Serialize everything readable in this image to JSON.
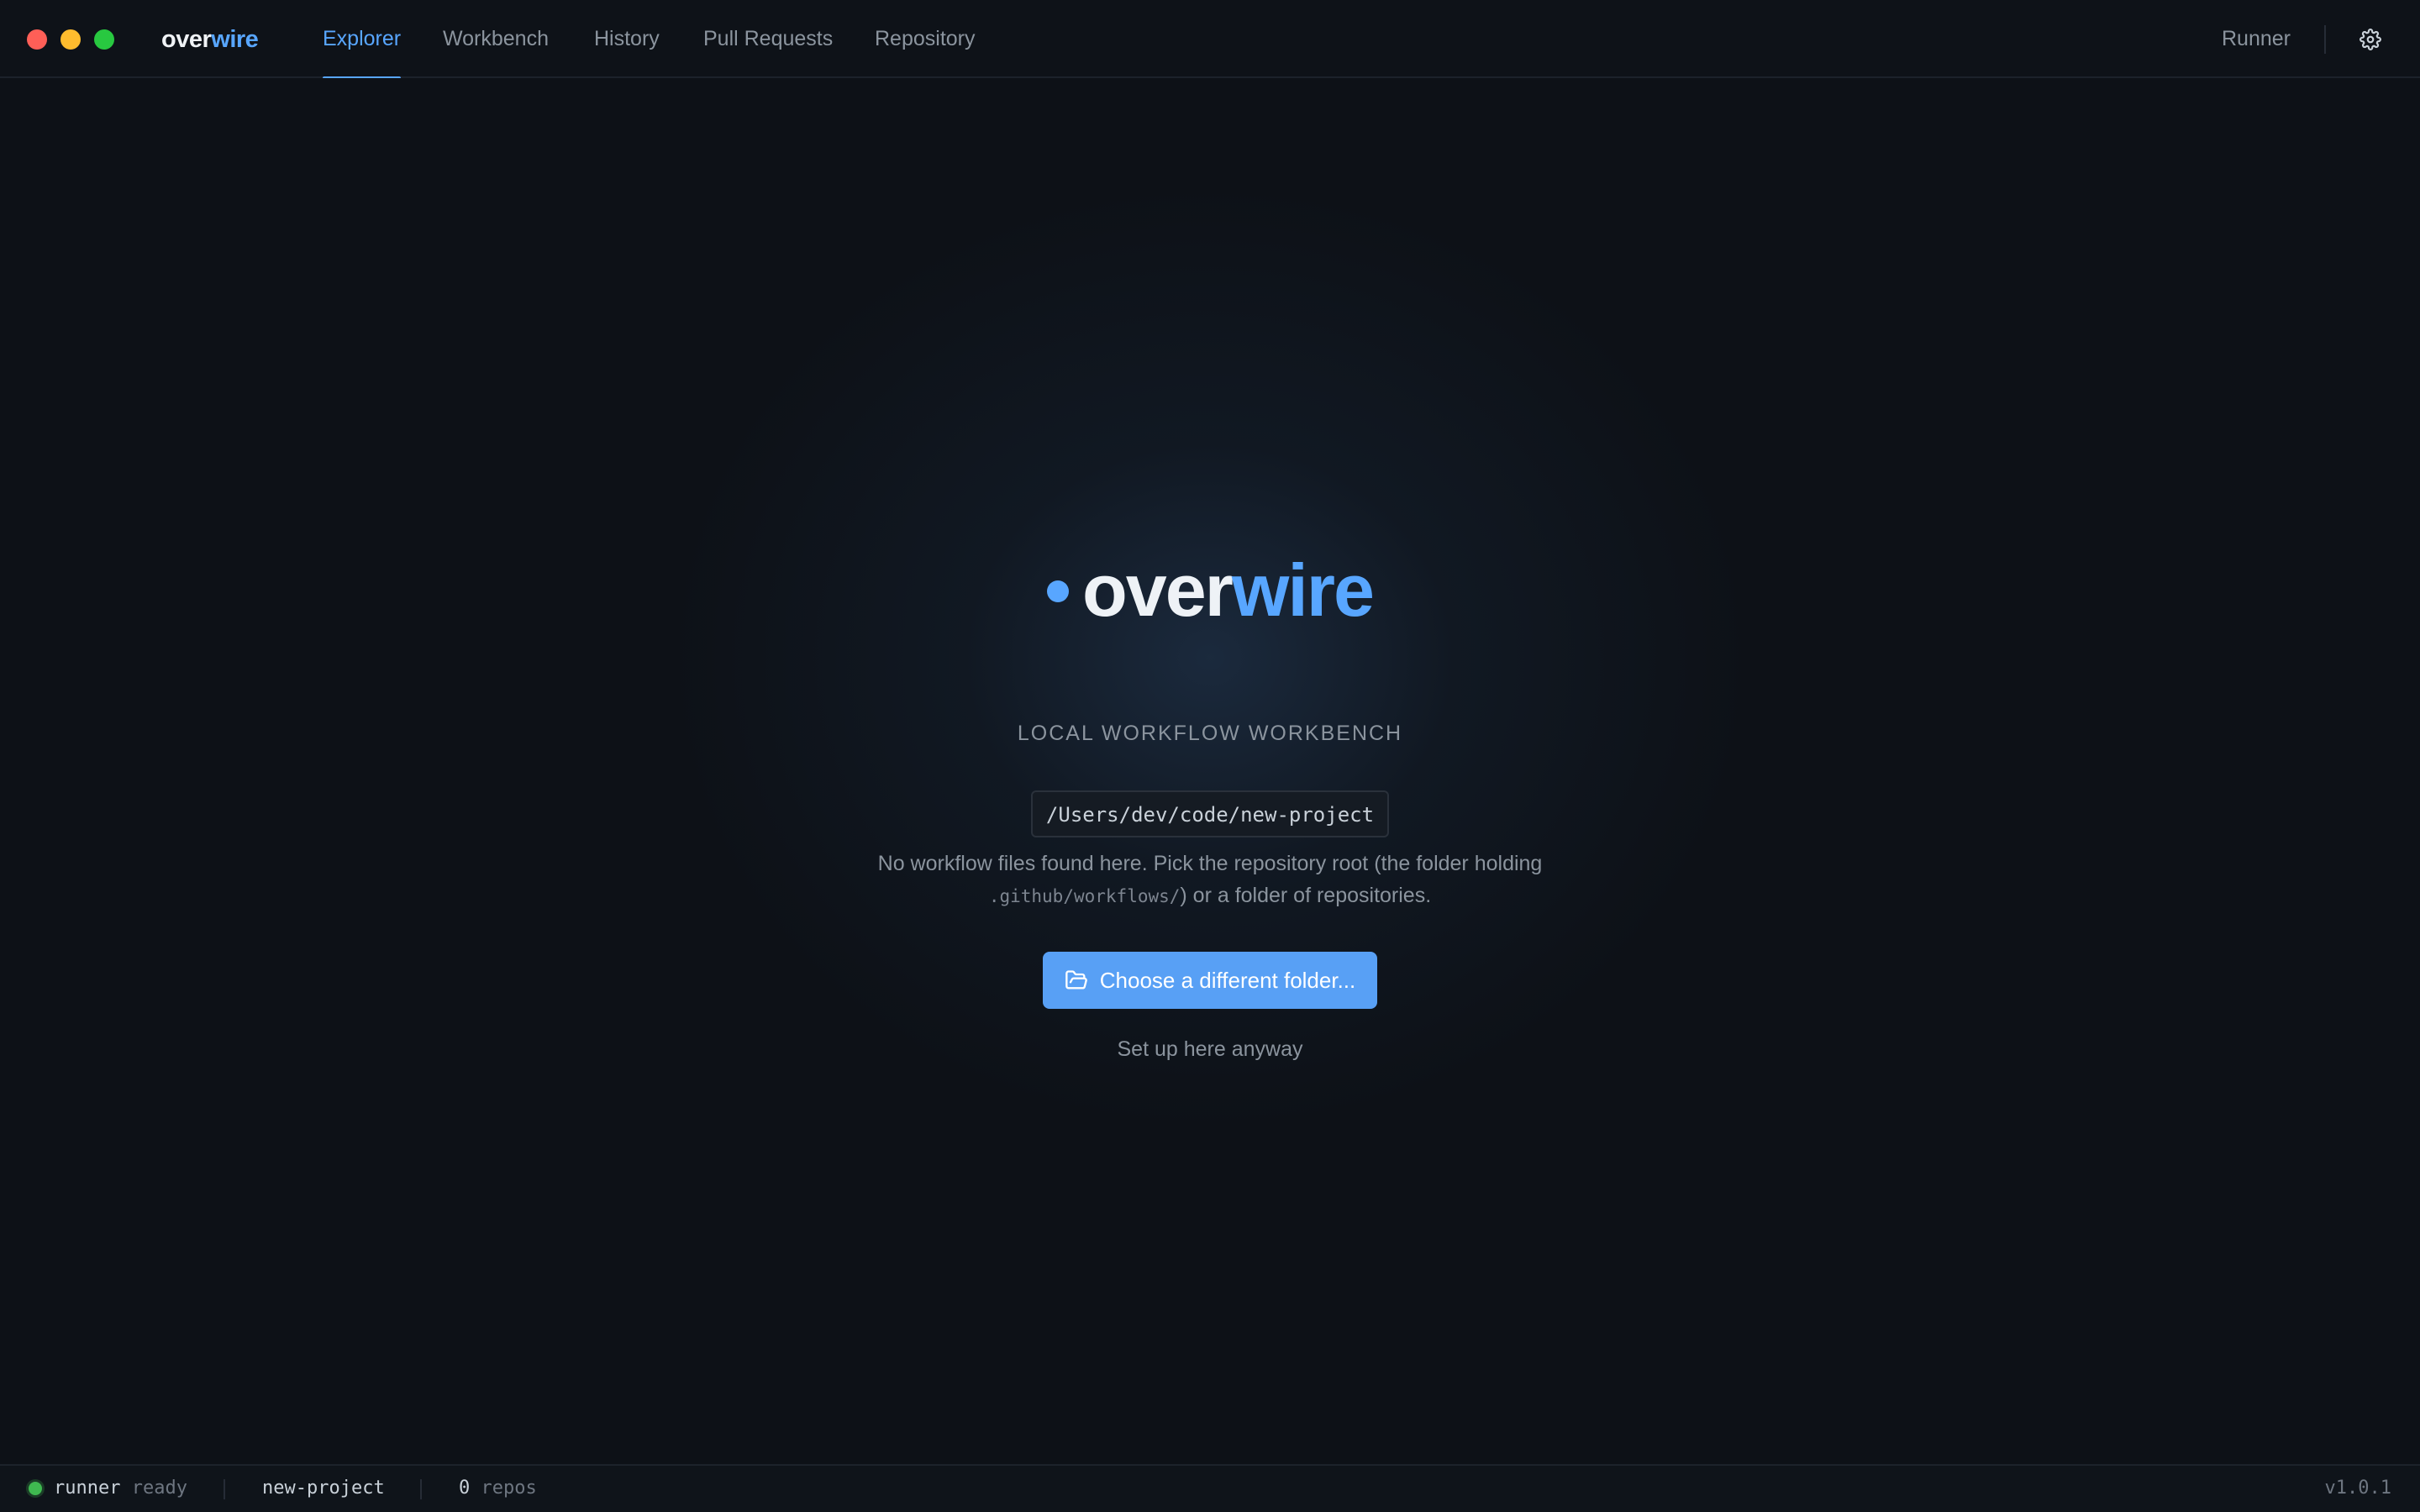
{
  "window": {
    "traffic_lights": [
      "close",
      "minimize",
      "zoom"
    ]
  },
  "brand": {
    "part1": "over",
    "part2": "wire"
  },
  "nav": {
    "tabs": [
      {
        "label": "Explorer",
        "active": true
      },
      {
        "label": "Workbench",
        "active": false
      },
      {
        "label": "History",
        "active": false
      },
      {
        "label": "Pull Requests",
        "active": false
      },
      {
        "label": "Repository",
        "active": false
      }
    ],
    "runner_label": "Runner",
    "settings_icon": "gear-icon"
  },
  "hero": {
    "title_part1": "over",
    "title_part2": "wire",
    "subtitle": "LOCAL WORKFLOW WORKBENCH",
    "path": "/Users/dev/code/new-project",
    "hint_line1": "No workflow files found here. Pick the repository root (the folder holding",
    "hint_code": ".github/workflows/",
    "hint_line2_rest": ") or a folder of repositories.",
    "primary_button": "Choose a different folder...",
    "primary_button_icon": "folder-open-icon",
    "secondary_link": "Set up here anyway"
  },
  "statusbar": {
    "runner_label": "runner",
    "runner_state": "ready",
    "project": "new-project",
    "repos_count": "0",
    "repos_label": "repos",
    "version": "v1.0.1"
  },
  "colors": {
    "accent": "#58a6ff",
    "button": "#58a0f5",
    "status_ok": "#3fb950",
    "background": "#0d1117"
  }
}
